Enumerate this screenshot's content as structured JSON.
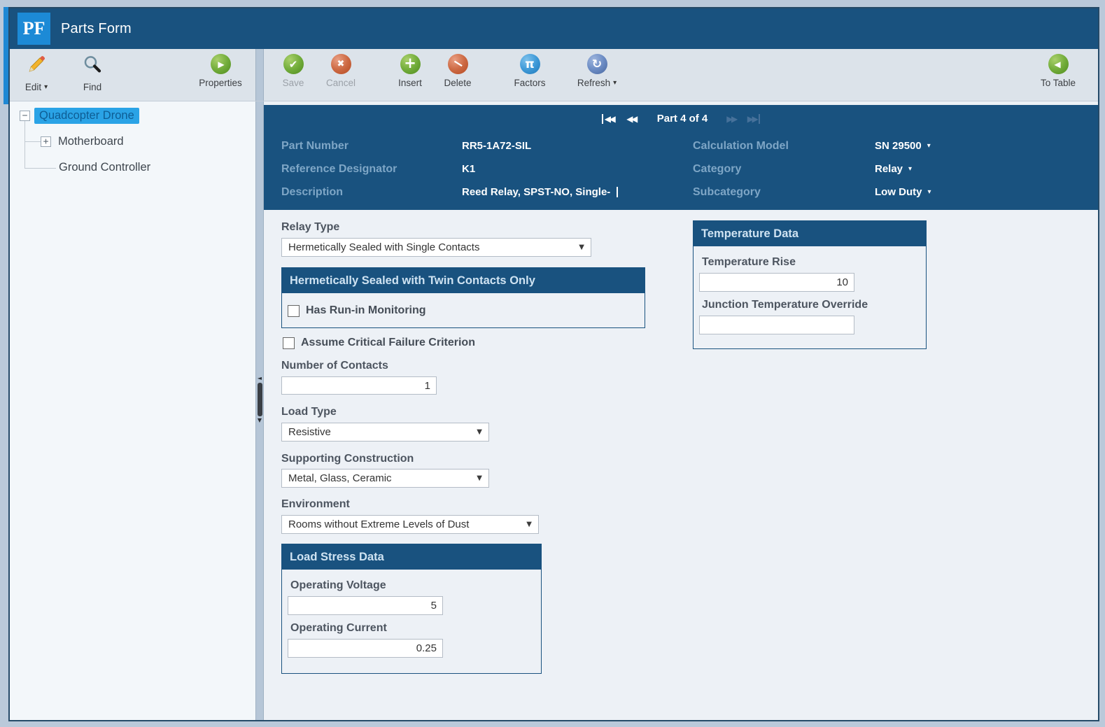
{
  "titlebar": {
    "logo": "PF",
    "title": "Parts Form"
  },
  "left_toolbar": {
    "edit_label": "Edit",
    "find_label": "Find",
    "properties_label": "Properties"
  },
  "main_toolbar": {
    "save_label": "Save",
    "cancel_label": "Cancel",
    "insert_label": "Insert",
    "delete_label": "Delete",
    "factors_label": "Factors",
    "refresh_label": "Refresh",
    "to_table_label": "To Table"
  },
  "tree": {
    "items": [
      {
        "label": "Quadcopter Drone",
        "expander": "collapse",
        "selected": true
      },
      {
        "label": "Motherboard",
        "expander": "expand",
        "selected": false
      },
      {
        "label": "Ground Controller",
        "expander": "none",
        "selected": false
      }
    ]
  },
  "record_nav": {
    "position": "Part 4 of 4"
  },
  "part_header": {
    "left": [
      {
        "label": "Part Number",
        "value": "RR5-1A72-SIL"
      },
      {
        "label": "Reference Designator",
        "value": "K1"
      },
      {
        "label": "Description",
        "value": "Reed Relay, SPST-NO, Single-"
      }
    ],
    "right": [
      {
        "label": "Calculation Model",
        "value": "SN 29500"
      },
      {
        "label": "Category",
        "value": "Relay"
      },
      {
        "label": "Subcategory",
        "value": "Low Duty"
      }
    ]
  },
  "form": {
    "relay_type": {
      "label": "Relay Type",
      "value": "Hermetically Sealed with Single Contacts"
    },
    "twin_contacts_section": {
      "title": "Hermetically Sealed with Twin Contacts Only",
      "checkbox_label": "Has Run-in Monitoring",
      "checked": false
    },
    "critical_failure": {
      "label": "Assume Critical Failure Criterion",
      "checked": false
    },
    "number_of_contacts": {
      "label": "Number of Contacts",
      "value": "1"
    },
    "load_type": {
      "label": "Load Type",
      "value": "Resistive"
    },
    "supporting_construction": {
      "label": "Supporting Construction",
      "value": "Metal, Glass, Ceramic"
    },
    "environment": {
      "label": "Environment",
      "value": "Rooms without Extreme Levels of Dust"
    },
    "load_stress": {
      "title": "Load Stress Data",
      "operating_voltage": {
        "label": "Operating Voltage",
        "value": "5"
      },
      "operating_current": {
        "label": "Operating Current",
        "value": "0.25"
      }
    },
    "temperature": {
      "title": "Temperature Data",
      "temperature_rise": {
        "label": "Temperature Rise",
        "value": "10"
      },
      "junction_override": {
        "label": "Junction Temperature Override",
        "value": ""
      }
    }
  },
  "icons": {
    "caret_down": "▾",
    "dropdown_arrow": "▼",
    "check": "✔",
    "cross": "✖",
    "plus": "+",
    "slash": "−",
    "pi": "π",
    "refresh": "↻",
    "play": "▶",
    "back": "◀",
    "nav_left": "◀◀",
    "nav_right": "▶▶",
    "tree_collapse": "−",
    "tree_expand": "+",
    "splitter_left": "◄",
    "splitter_down": "▼"
  },
  "colors": {
    "titlebar": "#19527f",
    "accent_blue": "#1c8ad6",
    "selection": "#2aa3e6",
    "section_header": "#19527f",
    "toolbar_bg": "#dce3ea",
    "page_bg": "#bac9da"
  }
}
